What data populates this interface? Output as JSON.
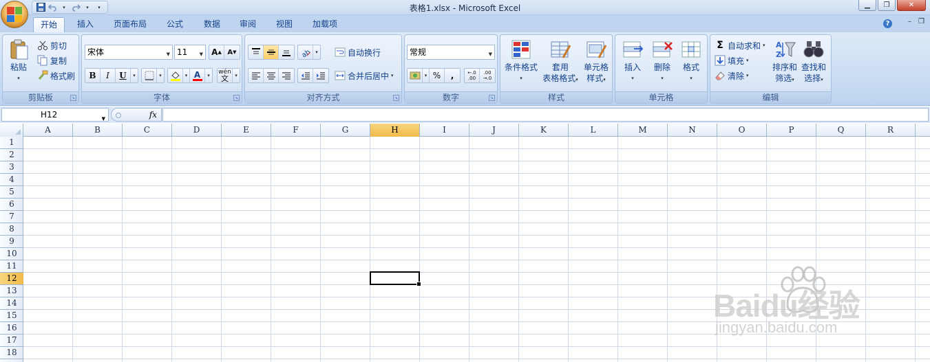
{
  "window": {
    "title": "表格1.xlsx - Microsoft Excel"
  },
  "qat": {
    "save": "save-icon",
    "undo": "undo-icon",
    "redo": "redo-icon"
  },
  "tabs": [
    {
      "label": "开始",
      "active": true
    },
    {
      "label": "插入"
    },
    {
      "label": "页面布局"
    },
    {
      "label": "公式"
    },
    {
      "label": "数据"
    },
    {
      "label": "审阅"
    },
    {
      "label": "视图"
    },
    {
      "label": "加载项"
    }
  ],
  "ribbon": {
    "clipboard": {
      "label": "剪贴板",
      "paste": "粘贴",
      "cut": "剪切",
      "copy": "复制",
      "format_painter": "格式刷"
    },
    "font": {
      "label": "字体",
      "font_name": "宋体",
      "font_size": "11",
      "bold": "B",
      "italic": "I",
      "underline": "U",
      "font_color_letter": "A",
      "phonetic": "wén",
      "phonetic2": "文"
    },
    "alignment": {
      "label": "对齐方式",
      "wrap_text": "自动换行",
      "merge_center": "合并后居中"
    },
    "number": {
      "label": "数字",
      "format": "常规",
      "percent": "%",
      "comma": ",",
      "inc_decimal_top": "←.0",
      "inc_decimal_bot": ".00",
      "dec_decimal_top": ".00",
      "dec_decimal_bot": "→.0"
    },
    "styles": {
      "label": "样式",
      "conditional": "条件格式",
      "table_1": "套用",
      "table_2": "表格格式",
      "cell_1": "单元格",
      "cell_2": "样式"
    },
    "cells": {
      "label": "单元格",
      "insert": "插入",
      "delete": "删除",
      "format": "格式"
    },
    "editing": {
      "label": "编辑",
      "autosum": "自动求和",
      "fill": "填充",
      "clear": "清除",
      "sort_1": "排序和",
      "sort_2": "筛选",
      "find_1": "查找和",
      "find_2": "选择"
    }
  },
  "formula_bar": {
    "name_box": "H12",
    "fx": "fx",
    "formula": ""
  },
  "grid": {
    "columns": [
      "A",
      "B",
      "C",
      "D",
      "E",
      "F",
      "G",
      "H",
      "I",
      "J",
      "K",
      "L",
      "M",
      "N",
      "O",
      "P",
      "Q",
      "R"
    ],
    "rows": [
      "1",
      "2",
      "3",
      "4",
      "5",
      "6",
      "7",
      "8",
      "9",
      "10",
      "11",
      "12",
      "13",
      "14",
      "15",
      "16",
      "17",
      "18"
    ],
    "selected_column": "H",
    "selected_row": "12"
  },
  "watermark": {
    "text": "Baidu经验",
    "url": "jingyan.baidu.com"
  },
  "colors": {
    "ribbon": "#c8dbf2",
    "selection_header": "#f1ba4a",
    "gridline": "#d0d7e5"
  }
}
